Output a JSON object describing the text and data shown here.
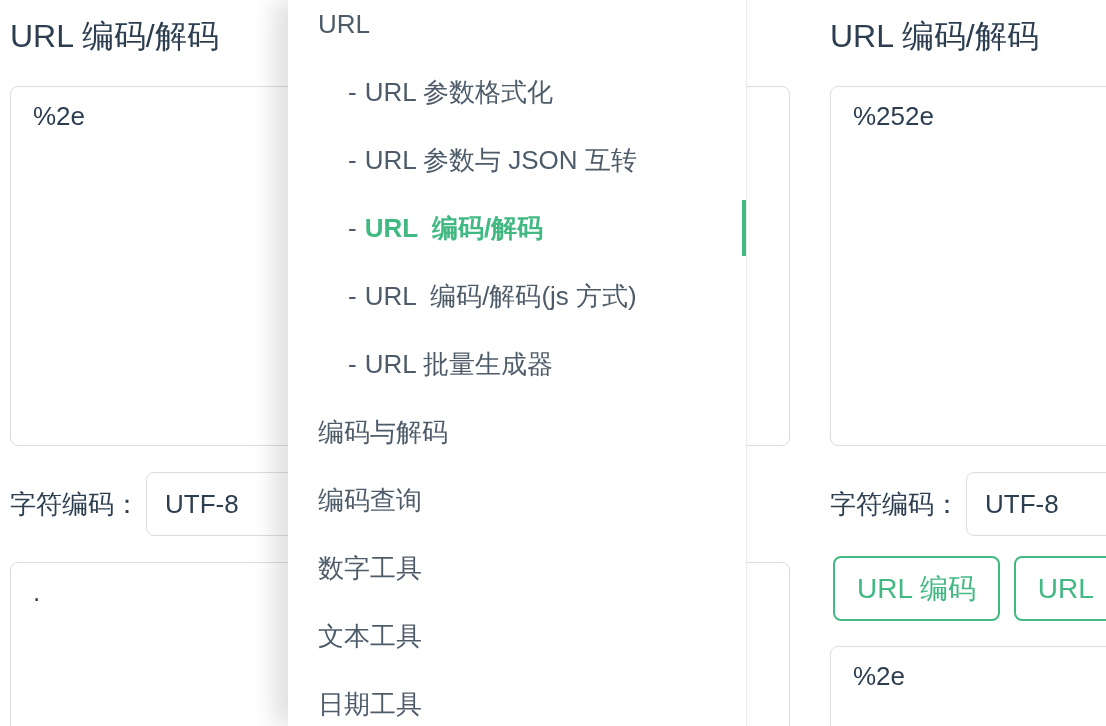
{
  "left_panel": {
    "title": "URL 编码/解码",
    "input": "%2e",
    "encoding_label": "字符编码：",
    "encoding": "UTF-8",
    "output": "."
  },
  "sidebar": {
    "items": [
      {
        "label": "URL",
        "selected": false,
        "children": [
          {
            "bullet": "-",
            "label": "URL 参数格式化",
            "selected": false
          },
          {
            "bullet": "-",
            "label": "URL 参数与 JSON 互转",
            "selected": false
          },
          {
            "bullet": "-",
            "label": "URL  编码/解码",
            "selected": true
          },
          {
            "bullet": "-",
            "label": "URL  编码/解码(js 方式)",
            "selected": false
          },
          {
            "bullet": "-",
            "label": "URL 批量生成器",
            "selected": false
          }
        ]
      },
      {
        "label": "编码与解码",
        "selected": false
      },
      {
        "label": "编码查询",
        "selected": false
      },
      {
        "label": "数字工具",
        "selected": false
      },
      {
        "label": "文本工具",
        "selected": false
      },
      {
        "label": "日期工具",
        "selected": false
      }
    ]
  },
  "right_panel": {
    "title": "URL 编码/解码",
    "input": "%252e",
    "encoding_label": "字符编码：",
    "encoding": "UTF-8",
    "buttons": [
      "URL 编码",
      "URL"
    ],
    "output": "%2e"
  }
}
